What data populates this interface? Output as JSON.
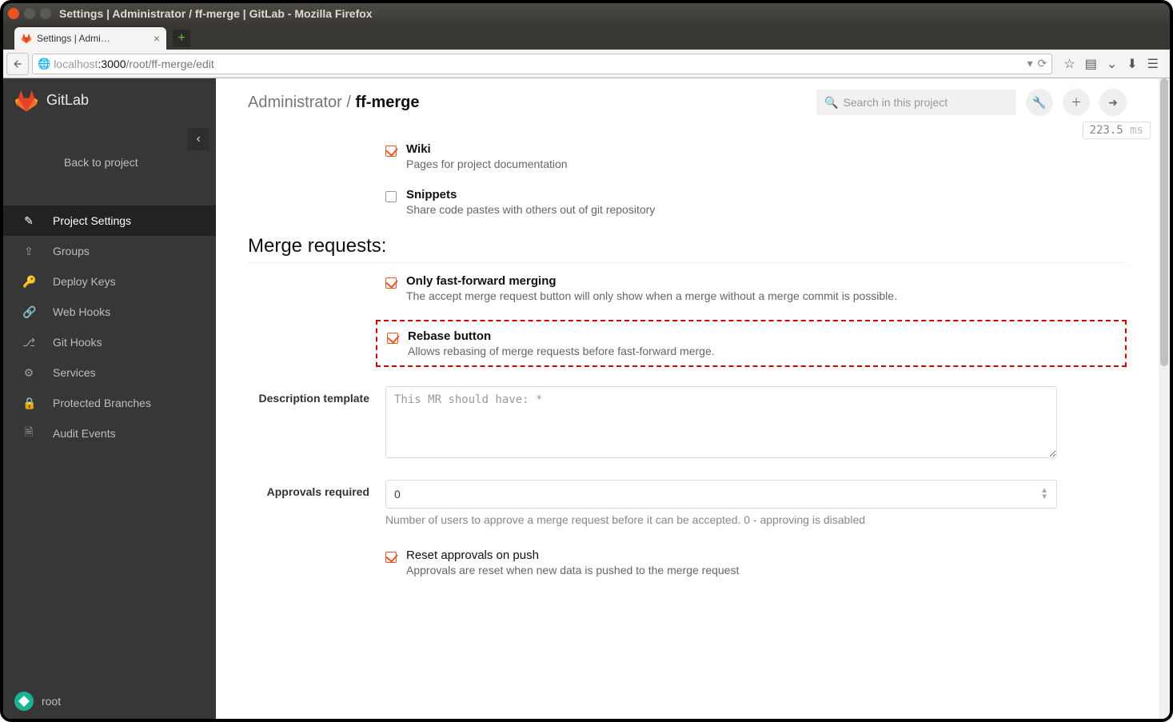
{
  "window": {
    "title": "Settings | Administrator / ff-merge | GitLab - Mozilla Firefox",
    "tab_label": "Settings | Admi…",
    "url_host_muted": "localhost",
    "url_host_bold": ":3000",
    "url_path": "/root/ff-merge/edit"
  },
  "sidebar": {
    "brand": "GitLab",
    "back": "Back to project",
    "items": [
      {
        "label": "Project Settings"
      },
      {
        "label": "Groups"
      },
      {
        "label": "Deploy Keys"
      },
      {
        "label": "Web Hooks"
      },
      {
        "label": "Git Hooks"
      },
      {
        "label": "Services"
      },
      {
        "label": "Protected Branches"
      },
      {
        "label": "Audit Events"
      }
    ],
    "user": "root"
  },
  "header": {
    "breadcrumb_parent": "Administrator",
    "breadcrumb_sep": " / ",
    "breadcrumb_current": "ff-merge",
    "search_placeholder": "Search in this project",
    "perf_value": "223.5",
    "perf_unit": " ms"
  },
  "features": {
    "wiki": {
      "label": "Wiki",
      "desc": "Pages for project documentation"
    },
    "snippets": {
      "label": "Snippets",
      "desc": "Share code pastes with others out of git repository"
    }
  },
  "merge_section": {
    "title": "Merge requests:",
    "ff": {
      "label": "Only fast-forward merging",
      "desc": "The accept merge request button will only show when a merge without a merge commit is possible."
    },
    "rebase": {
      "label": "Rebase button",
      "desc": "Allows rebasing of merge requests before fast-forward merge."
    },
    "desc_template": {
      "label": "Description template",
      "placeholder": "This MR should have: *"
    },
    "approvals": {
      "label": "Approvals required",
      "value": "0",
      "hint": "Number of users to approve a merge request before it can be accepted. 0 - approving is disabled"
    },
    "reset": {
      "label": "Reset approvals on push",
      "desc": "Approvals are reset when new data is pushed to the merge request"
    }
  }
}
